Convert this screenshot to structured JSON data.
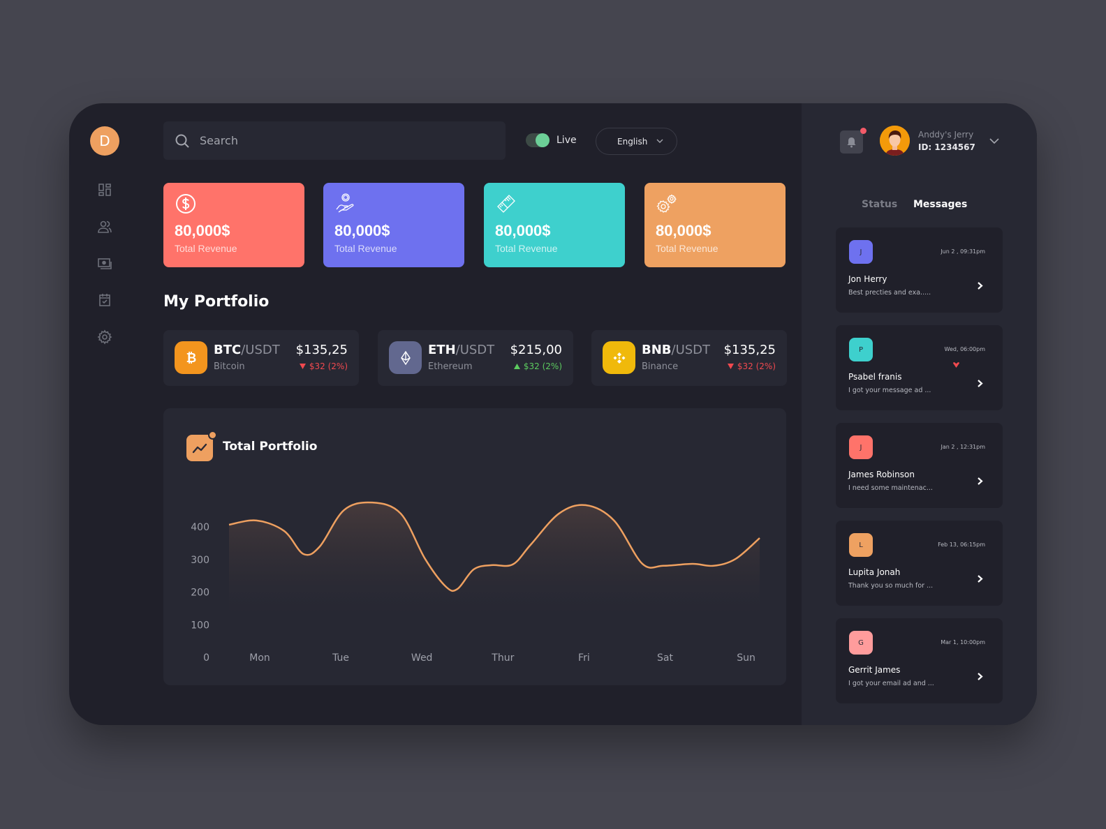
{
  "app": {
    "logo_letter": "D",
    "accent": "#eea060"
  },
  "sidebar": {
    "items": [
      {
        "name": "dashboard",
        "icon": "grid-icon"
      },
      {
        "name": "users",
        "icon": "users-icon"
      },
      {
        "name": "payments",
        "icon": "cash-icon"
      },
      {
        "name": "calendar",
        "icon": "calendar-check-icon"
      },
      {
        "name": "settings",
        "icon": "gear-icon"
      }
    ]
  },
  "header": {
    "search_placeholder": "Search",
    "search_value": "",
    "live_label": "Live",
    "live_on": true,
    "language": "English"
  },
  "stat_cards": [
    {
      "value": "80,000$",
      "label": "Total Revenue",
      "icon": "dollar-circle-icon",
      "color": "#ff736a"
    },
    {
      "value": "80,000$",
      "label": "Total Revenue",
      "icon": "hand-coin-icon",
      "color": "#6e71ef"
    },
    {
      "value": "80,000$",
      "label": "Total Revenue",
      "icon": "ticket-icon",
      "color": "#3ed0cd"
    },
    {
      "value": "80,000$",
      "label": "Total Revenue",
      "icon": "gears-icon",
      "color": "#eea161"
    }
  ],
  "portfolio": {
    "title": "My Portfolio",
    "coins": [
      {
        "symbol": "BTC",
        "quote": "/USDT",
        "name": "Bitcoin",
        "price": "$135,25",
        "change": "$32 (2%)",
        "direction": "down",
        "color": "#f3951e",
        "icon": "bitcoin-icon"
      },
      {
        "symbol": "ETH",
        "quote": "/USDT",
        "name": "Ethereum",
        "price": "$215,00",
        "change": "$32 (2%)",
        "direction": "up",
        "color": "#62688f",
        "icon": "ethereum-icon"
      },
      {
        "symbol": "BNB",
        "quote": "/USDT",
        "name": "Binance",
        "price": "$135,25",
        "change": "$32 (2%)",
        "direction": "down",
        "color": "#f0b90b",
        "icon": "binance-icon"
      }
    ],
    "up_color": "#5ccb5f",
    "down_color": "#f1494f"
  },
  "chart_data": {
    "type": "area",
    "title": "Total Portfolio",
    "categories": [
      "Mon",
      "Tue",
      "Wed",
      "Thur",
      "Fri",
      "Sat",
      "Sun"
    ],
    "yticks": [
      "0",
      "100",
      "200",
      "300",
      "400"
    ],
    "ylim": [
      0,
      400
    ],
    "xlabel": "",
    "ylabel": "",
    "grid": false,
    "series": [
      {
        "name": "Total Portfolio",
        "color": "#eea060",
        "x": [
          -0.38,
          -0.04,
          0.3,
          0.54,
          0.74,
          1.04,
          1.39,
          1.74,
          2.04,
          2.3,
          2.44,
          2.64,
          2.86,
          3.12,
          3.34,
          3.69,
          4.02,
          4.37,
          4.72,
          4.98,
          5.34,
          5.6,
          5.87,
          6.18
        ],
        "values": [
          407,
          420,
          388,
          317,
          340,
          452,
          475,
          441,
          302,
          216,
          210,
          270,
          283,
          285,
          345,
          441,
          467,
          420,
          287,
          281,
          287,
          281,
          302,
          366
        ]
      }
    ]
  },
  "user": {
    "name": "Anddy's Jerry",
    "id_label": "ID: 1234567",
    "has_notification": true
  },
  "right_tabs": [
    {
      "label": "Status",
      "active": false
    },
    {
      "label": "Messages",
      "active": true
    }
  ],
  "messages": [
    {
      "initial": "J",
      "name": "Jon Herry",
      "text": "Best precties and exa.....",
      "time": "Jun 2 , 09:31pm",
      "color": "#6e71ef",
      "liked": false
    },
    {
      "initial": "P",
      "name": "Psabel franis",
      "text": "I got your message ad ...",
      "time": "Wed, 06:00pm",
      "color": "#3ed0cd",
      "liked": true
    },
    {
      "initial": "J",
      "name": "James Robinson",
      "text": "I need some maintenac...",
      "time": "Jan 2 , 12:31pm",
      "color": "#ff736a",
      "liked": false
    },
    {
      "initial": "L",
      "name": "Lupita Jonah",
      "text": "Thank you so much for ...",
      "time": "Feb 13, 06:15pm",
      "color": "#eea161",
      "liked": false
    },
    {
      "initial": "G",
      "name": "Gerrit James",
      "text": "I got your email ad and ...",
      "time": "Mar 1, 10:00pm",
      "color": "#ff9c9c",
      "liked": false
    }
  ]
}
